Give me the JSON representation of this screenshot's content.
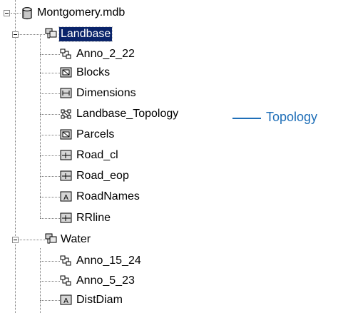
{
  "tree": {
    "root": {
      "label": "Montgomery.mdb",
      "icon": "database-icon",
      "expanded": true
    },
    "datasets": [
      {
        "label": "Landbase",
        "icon": "feature-dataset-icon",
        "expanded": true,
        "selected": true,
        "children": [
          {
            "label": "Anno_2_22",
            "icon": "annotation-class-icon"
          },
          {
            "label": "Blocks",
            "icon": "polygon-class-icon"
          },
          {
            "label": "Dimensions",
            "icon": "dimension-class-icon"
          },
          {
            "label": "Landbase_Topology",
            "icon": "topology-icon"
          },
          {
            "label": "Parcels",
            "icon": "polygon-class-icon"
          },
          {
            "label": "Road_cl",
            "icon": "line-class-icon"
          },
          {
            "label": "Road_eop",
            "icon": "line-class-icon"
          },
          {
            "label": "RoadNames",
            "icon": "annotation-text-icon"
          },
          {
            "label": "RRline",
            "icon": "line-class-icon"
          }
        ]
      },
      {
        "label": "Water",
        "icon": "feature-dataset-icon",
        "expanded": true,
        "selected": false,
        "children": [
          {
            "label": "Anno_15_24",
            "icon": "annotation-class-icon"
          },
          {
            "label": "Anno_5_23",
            "icon": "annotation-class-icon"
          },
          {
            "label": "DistDiam",
            "icon": "annotation-text-icon"
          }
        ]
      }
    ]
  },
  "callout": {
    "label": "Topology",
    "color": "#1f6fb8"
  },
  "colors": {
    "selection": "#0a246a",
    "line": "#7a7a7a"
  }
}
